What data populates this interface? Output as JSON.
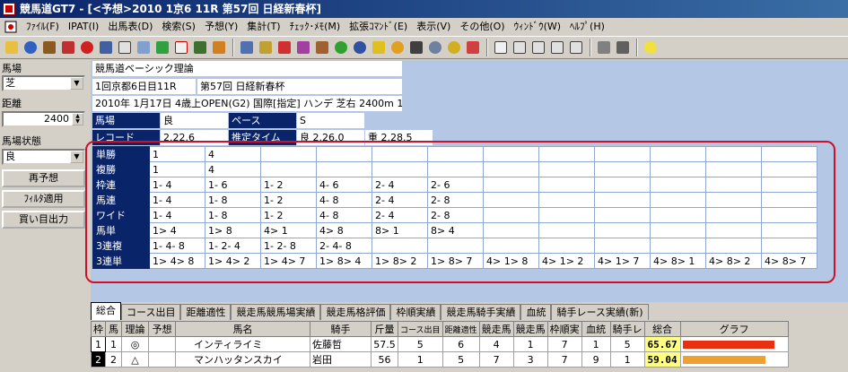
{
  "window": {
    "title": "競馬道GT7 - [<予想>2010 1京6 11R 第57回 日経新春杯]"
  },
  "menu": [
    "ﾌｧｲﾙ(F)",
    "IPAT(I)",
    "出馬表(D)",
    "検索(S)",
    "予想(Y)",
    "集計(T)",
    "ﾁｪｯｸ･ﾒﾓ(M)",
    "拡張ｺﾏﾝﾄﾞ(E)",
    "表示(V)",
    "その他(O)",
    "ｳｨﾝﾄﾞｳ(W)",
    "ﾍﾙﾌﾟ(H)"
  ],
  "sidebar": {
    "baba_label": "馬場",
    "baba_value": "芝",
    "kyori_label": "距離",
    "kyori_value": "2400",
    "jotai_label": "馬場状態",
    "jotai_value": "良",
    "btn_resim": "再予想",
    "btn_filter": "ﾌｨﾙﾀ適用",
    "btn_kaime": "買い目出力"
  },
  "header": {
    "theory": "競馬道ベーシック理論",
    "race_day": "1回京都6日目11R",
    "race_name": "第57回 日経新春杯",
    "race_info": "2010年 1月17日  4歳上OPEN(G2) 国際[指定] ハンデ 芝右 2400m 12頭",
    "baba_h": "馬場",
    "baba_v": "良",
    "pace_h": "ペース",
    "pace_v": "S",
    "record_h": "レコード",
    "record_v": "2.22.6",
    "est_h": "推定タイム",
    "est_v": "良 2.26.0",
    "est_v2": "重 2.28.5"
  },
  "tickets": [
    {
      "label": "単勝",
      "values": [
        "1",
        "4"
      ]
    },
    {
      "label": "複勝",
      "values": [
        "1",
        "4"
      ]
    },
    {
      "label": "枠連",
      "values": [
        "1- 4",
        "1- 6",
        "1- 2",
        "4- 6",
        "2- 4",
        "2- 6"
      ]
    },
    {
      "label": "馬連",
      "values": [
        "1- 4",
        "1- 8",
        "1- 2",
        "4- 8",
        "2- 4",
        "2- 8"
      ]
    },
    {
      "label": "ワイド",
      "values": [
        "1- 4",
        "1- 8",
        "1- 2",
        "4- 8",
        "2- 4",
        "2- 8"
      ]
    },
    {
      "label": "馬単",
      "values": [
        "1> 4",
        "1> 8",
        "4> 1",
        "4> 8",
        "8> 1",
        "8> 4"
      ]
    },
    {
      "label": "3連複",
      "values": [
        "1- 4- 8",
        "1- 2- 4",
        "1- 2- 8",
        "2- 4- 8"
      ]
    },
    {
      "label": "3連単",
      "values": [
        "1> 4> 8",
        "1> 4> 2",
        "1> 4> 7",
        "1> 8> 4",
        "1> 8> 2",
        "1> 8> 7",
        "4> 1> 8",
        "4> 1> 2",
        "4> 1> 7",
        "4> 8> 1",
        "4> 8> 2",
        "4> 8> 7"
      ]
    }
  ],
  "tabs": [
    "総合",
    "コース出目",
    "距離適性",
    "競走馬競馬場実績",
    "競走馬格評価",
    "枠順実績",
    "競走馬騎手実績",
    "血統",
    "騎手レース実績(新)"
  ],
  "runner_headers": [
    "枠",
    "馬",
    "理論",
    "予想",
    "馬名",
    "騎手",
    "斤量",
    "コース出目",
    "距離適性",
    "競走馬",
    "競走馬",
    "枠順実",
    "血統",
    "騎手レ",
    "総合",
    "グラフ"
  ],
  "runners": [
    {
      "waku": "1",
      "uma": "1",
      "riron": "◎",
      "yoso": "",
      "name": "インティライミ",
      "jockey": "佐藤哲",
      "kin": "57.5",
      "c1": "5",
      "c2": "6",
      "c3": "4",
      "c4": "1",
      "c5": "7",
      "c6": "1",
      "c7": "5",
      "c8": "1",
      "total": "65.67",
      "ratio": 0.93,
      "barcolor": "#e83010"
    },
    {
      "waku": "2",
      "uma": "2",
      "riron": "△",
      "yoso": "",
      "name": "マンハッタンスカイ",
      "jockey": "岩田",
      "kin": "56",
      "c1": "1",
      "c2": "5",
      "c3": "7",
      "c4": "3",
      "c5": "7",
      "c6": "9",
      "c7": "1",
      "c8": "3",
      "total": "59.04",
      "ratio": 0.84,
      "barcolor": "#f0a030"
    }
  ],
  "colors": {
    "accent": "#0a246a",
    "panel": "#b4c8e6",
    "highlight": "#d0102a"
  }
}
